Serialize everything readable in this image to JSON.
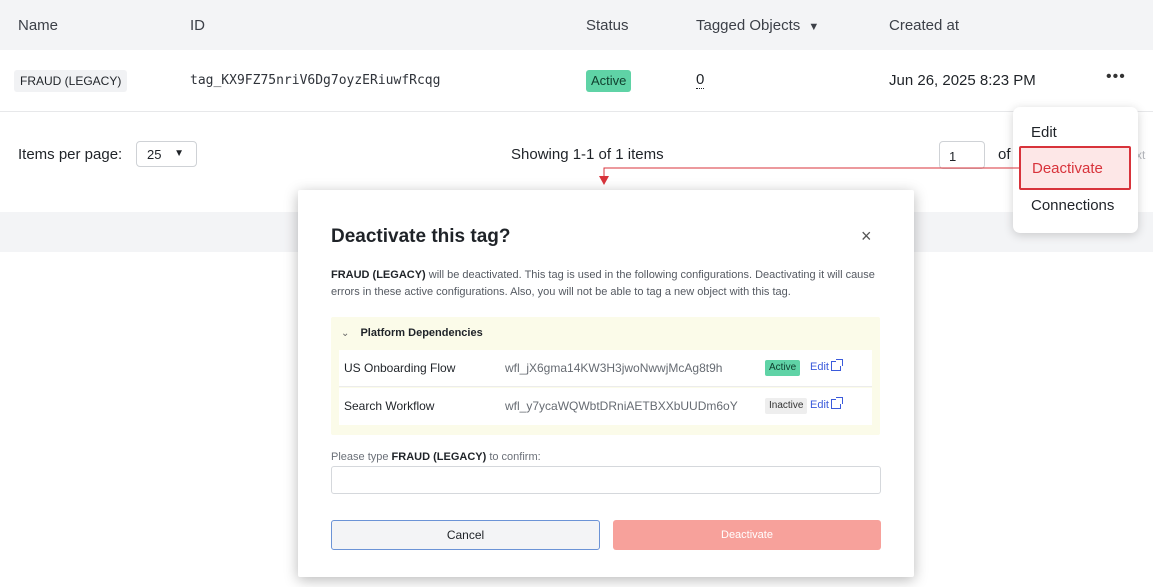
{
  "table": {
    "columns": {
      "name": "Name",
      "id": "ID",
      "status": "Status",
      "tagged_objects": "Tagged Objects",
      "created_at": "Created at"
    },
    "sort_icon": "caret-down-icon",
    "rows": [
      {
        "name": "FRAUD (LEGACY)",
        "id": "tag_KX9FZ75nriV6Dg7oyzERiuwfRcqg",
        "status": "Active",
        "tagged_objects": "0",
        "created_at": "Jun 26, 2025 8:23 PM",
        "more_icon": "more-horizontal-icon"
      }
    ]
  },
  "pagination": {
    "items_per_page_label": "Items per page:",
    "items_per_page_value": "25",
    "showing": "Showing 1-1 of 1 items",
    "page": "1",
    "of_label": "of",
    "next_label": "xt"
  },
  "row_menu": {
    "items": [
      "Edit",
      "Deactivate",
      "Connections"
    ]
  },
  "modal": {
    "title": "Deactivate this tag?",
    "close_icon": "close-icon",
    "desc_tag": "FRAUD (LEGACY)",
    "desc_rest": " will be deactivated. This tag is used in the following configurations. Deactivating it will cause errors in these active configurations. Also, you will not be able to tag a new object with this tag.",
    "dependencies": {
      "title": "Platform Dependencies",
      "rows": [
        {
          "name": "US Onboarding Flow",
          "id": "wfl_jX6gma14KW3H3jwoNwwjMcAg8t9h",
          "status": "Active",
          "edit": "Edit"
        },
        {
          "name": "Search Workflow",
          "id": "wfl_y7ycaWQWbtDRniAETBXXbUUDm6oY",
          "status": "Inactive",
          "edit": "Edit"
        }
      ]
    },
    "confirm_prefix": "Please type ",
    "confirm_tag": "FRAUD (LEGACY)",
    "confirm_suffix": " to confirm:",
    "confirm_value": "",
    "cancel_label": "Cancel",
    "deactivate_label": "Deactivate"
  },
  "colors": {
    "active_badge": "#5fd3a6",
    "highlight_red": "#d8333b",
    "deactivate_button": "#f7a19b",
    "dependencies_bg": "#fbfbe9"
  }
}
